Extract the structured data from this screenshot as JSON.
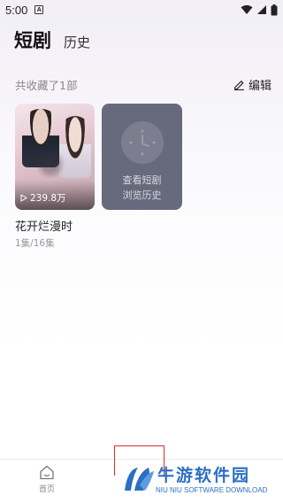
{
  "status_bar": {
    "time": "5:00",
    "notification_letter": "A"
  },
  "tabs": {
    "active": "短剧",
    "inactive": "历史"
  },
  "collection": {
    "count_label": "共收藏了1部",
    "edit_label": "编辑"
  },
  "dramas": [
    {
      "title": "花开烂漫时",
      "episodes": "1集/16集",
      "views": "239.8万"
    }
  ],
  "history_card": {
    "line1": "查看短剧",
    "line2": "浏览历史"
  },
  "bottom_nav": {
    "home_label": "首页"
  },
  "watermark": {
    "title": "牛游软件园",
    "subtitle": "NIU NIU SOFTWARE DOWNLOAD"
  },
  "colors": {
    "accent_blue": "#2b6fc4",
    "highlight_red": "#e02a2a",
    "history_card_bg": "#67697c"
  }
}
